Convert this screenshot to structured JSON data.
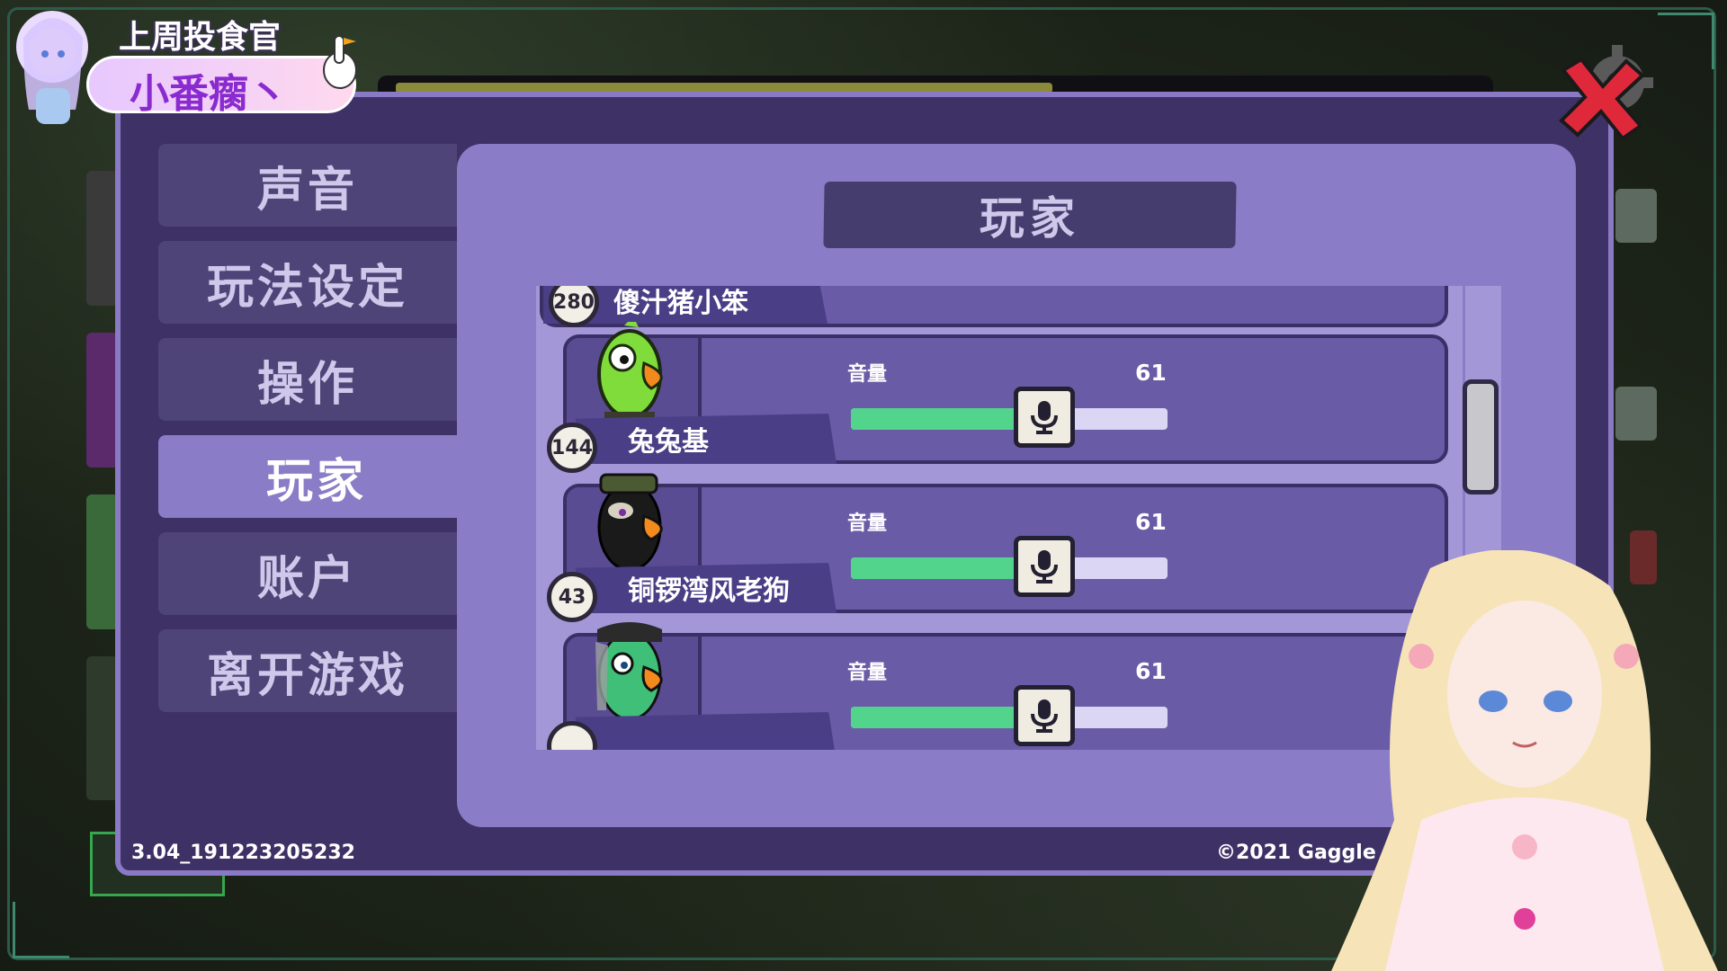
{
  "badge": {
    "title": "上周投食官",
    "name": "小番瘸丶"
  },
  "menu": {
    "items": [
      {
        "label": "声音",
        "active": false
      },
      {
        "label": "玩法设定",
        "active": false
      },
      {
        "label": "操作",
        "active": false
      },
      {
        "label": "玩家",
        "active": true
      },
      {
        "label": "账户",
        "active": false
      },
      {
        "label": "离开游戏",
        "active": false
      }
    ]
  },
  "content": {
    "title": "玩家"
  },
  "players": [
    {
      "level": "280",
      "name": "傻汁猪小笨",
      "partial": true
    },
    {
      "level": "144",
      "name": "兔兔基",
      "volume_label": "音量",
      "volume": 61,
      "skin": "green-soldier-icon"
    },
    {
      "level": "43",
      "name": "铜锣湾风老狗",
      "volume_label": "音量",
      "volume": 61,
      "skin": "black-cap-icon"
    },
    {
      "level": "",
      "name": "",
      "volume_label": "音量",
      "volume": 61,
      "skin": "green-veil-icon"
    }
  ],
  "footer": {
    "version": "3.04_191223205232",
    "copyright": "©2021 Gaggle Stu"
  },
  "colors": {
    "panel": "#3d3166",
    "panel_border": "#8a79c4",
    "content": "#8a7cc6",
    "menu_item": "#4e4477",
    "slider_fill": "#52d48d",
    "close_red": "#e0283b"
  }
}
